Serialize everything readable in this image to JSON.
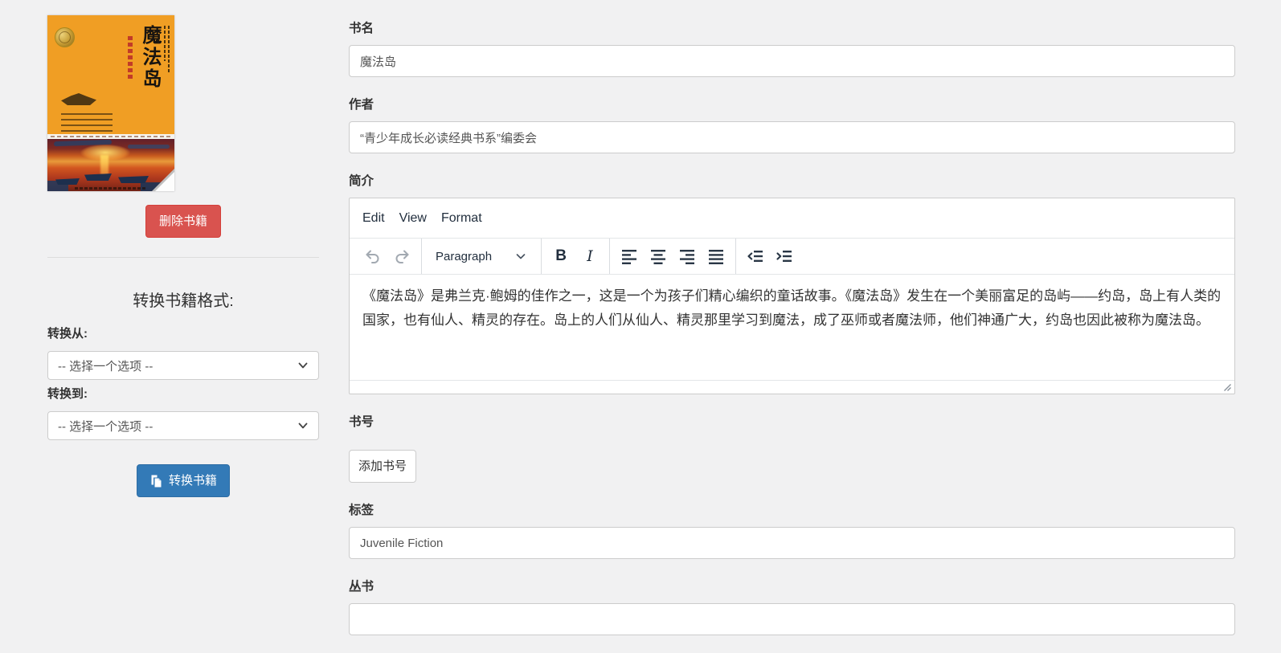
{
  "colors": {
    "page_bg": "#f1f1f2",
    "accent_blue": "#337ab7",
    "danger_red": "#d9534f",
    "editor_icon": "#222f3e",
    "cover_orange": "#f09e24"
  },
  "sidebar": {
    "cover": {
      "title": "魔法岛"
    },
    "delete_button_label": "删除书籍",
    "convert_heading": "转换书籍格式:",
    "convert_from_label": "转换从:",
    "convert_to_label": "转换到:",
    "select_placeholder": "-- 选择一个选项 --",
    "convert_button_label": "转换书籍"
  },
  "form": {
    "book_title": {
      "label": "书名",
      "value": "魔法岛"
    },
    "authors": {
      "label": "作者",
      "value": "“青少年成长必读经典书系”编委会"
    },
    "description": {
      "label": "简介"
    },
    "identifiers": {
      "label": "书号",
      "add_button_label": "添加书号"
    },
    "tags": {
      "label": "标签",
      "value": "Juvenile Fiction"
    },
    "series": {
      "label": "丛书",
      "value": ""
    }
  },
  "editor": {
    "menu": [
      "Edit",
      "View",
      "Format"
    ],
    "block_format": "Paragraph",
    "content": "《魔法岛》是弗兰克·鲍姆的佳作之一，这是一个为孩子们精心编织的童话故事。《魔法岛》发生在一个美丽富足的岛屿——约岛，岛上有人类的国家，也有仙人、精灵的存在。岛上的人们从仙人、精灵那里学习到魔法，成了巫师或者魔法师，他们神通广大，约岛也因此被称为魔法岛。",
    "icons": {
      "bold": "B",
      "italic": "I",
      "undo": "undo-arrow",
      "redo": "redo-arrow",
      "align_left": "align-left-bars",
      "align_center": "align-center-bars",
      "align_right": "align-right-bars",
      "justify": "justify-bars",
      "outdent": "outdent-arrow-bars",
      "indent": "indent-arrow-bars",
      "chevron_down": "v",
      "duplicate": "two-pages",
      "resize": "diagonal-grip"
    }
  }
}
